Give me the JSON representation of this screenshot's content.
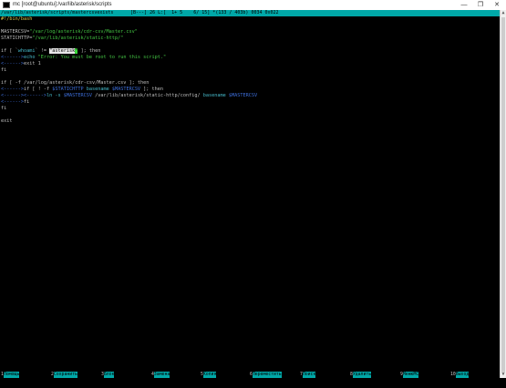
{
  "window": {
    "title": "mc [root@ubuntu]:/var/lib/asterisk/scripts",
    "minimize": "—",
    "maximize": "❐",
    "close": "✕"
  },
  "status": {
    "path": "/var/lib/asterisk/scripts/mastercsvexists",
    "flags": "[B---] 26 L:[  1+ 5    6/ 15] *(133 / 403b) 0034 0x022"
  },
  "code": {
    "shebang": "#!/bin/bash",
    "mastercsv_var": "MASTERCSV=",
    "mastercsv_val": "\"/var/log/asterisk/cdr-csv/Master.csv\"",
    "static_var": "STATICHTTP=",
    "static_val": "\"/var/lib/asterisk/static-http/\"",
    "if1_a": "if [ `",
    "if1_whoami": "whoami",
    "if1_b": "` != ",
    "if1_asterisk": "\"asterisk",
    "if1_cursor": "\"",
    "if1_c": " ]; then",
    "tab1": "<------>",
    "echo_kw": "echo ",
    "echo_str": "\"Error: You must be root to run this script.\"",
    "tab2": "<------>",
    "exit1": "exit 1",
    "fi1": "fi",
    "if2_a": "if [ -f /var/log/asterisk/cdr-csv/Master.csv ]; then",
    "tab3": "<------>",
    "if3_a": "if [ ! -f ",
    "if3_var": "$STATICHTTP",
    "if3_b": "basename ",
    "if3_var2": "$MASTERCSV",
    "if3_c": " ]; then",
    "tab4": "<------><------>",
    "ln_cmd": "ln -s ",
    "ln_var": "$MASTERCSV",
    "ln_path": " /var/lib/asterisk/static-http/config/ ",
    "ln_basename": "basename ",
    "ln_var2": "$MASTERCSV",
    "tab5": "<------>",
    "fi2": "fi",
    "fi3": "fi",
    "exit_kw": "exit"
  },
  "fkeys": [
    {
      "num": "1",
      "label": "Помощь"
    },
    {
      "num": "2",
      "label": "Сохранить"
    },
    {
      "num": "3",
      "label": "Блок"
    },
    {
      "num": "4",
      "label": "Замена"
    },
    {
      "num": "5",
      "label": "Копия"
    },
    {
      "num": "6",
      "label": "Переместить"
    },
    {
      "num": "7",
      "label": "Поиск"
    },
    {
      "num": "8",
      "label": "Удалить"
    },
    {
      "num": "9",
      "label": "МенюMC"
    },
    {
      "num": "10",
      "label": "Выход"
    }
  ],
  "colors": {
    "background": "#000000",
    "status_bar": "#00a8a8",
    "string": "#44c744",
    "keyword": "#d7c64a",
    "variable": "#3c6dd8",
    "command": "#45b8c8"
  }
}
